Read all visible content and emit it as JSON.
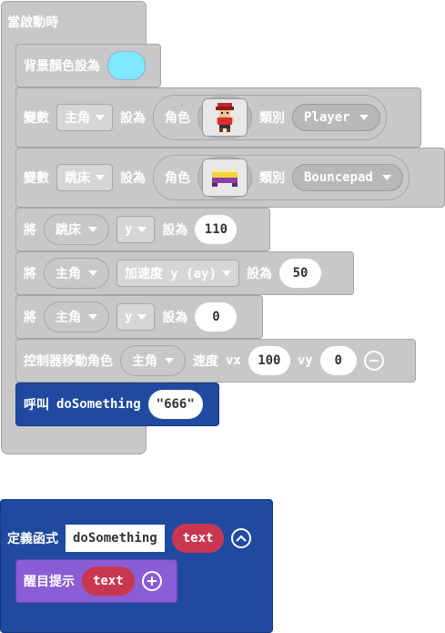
{
  "start_event": {
    "label": "當啟動時"
  },
  "set_bg": {
    "label": "背景顏色設為",
    "color": "#7fe8ff"
  },
  "set_hero": {
    "var_label": "變數",
    "var_name": "主角",
    "set_label": "設為",
    "sprite_label": "角色",
    "kind_label": "類別",
    "kind_value": "Player",
    "sprite_icon": "player-sprite-icon"
  },
  "set_bounce": {
    "var_label": "變數",
    "var_name": "跳床",
    "set_label": "設為",
    "sprite_label": "角色",
    "kind_label": "類別",
    "kind_value": "Bouncepad",
    "sprite_icon": "bouncepad-sprite-icon"
  },
  "set_y": {
    "label": "將",
    "target": "跳床",
    "prop": "y",
    "set_label": "設為",
    "value": "110"
  },
  "set_ay": {
    "label": "將",
    "target": "主角",
    "prop": "加速度 y (ay)",
    "set_label": "設為",
    "value": "50"
  },
  "set_y2": {
    "label": "將",
    "target": "主角",
    "prop": "y",
    "set_label": "設為",
    "value": "0"
  },
  "controller": {
    "label": "控制器移動角色",
    "target": "主角",
    "speed_label": "速度",
    "vx_label": "vx",
    "vx": "100",
    "vy_label": "vy",
    "vy": "0"
  },
  "call": {
    "label": "呼叫",
    "func": "doSomething",
    "arg": "\"666\""
  },
  "func_def": {
    "label": "定義函式",
    "name": "doSomething",
    "param": "text"
  },
  "splash": {
    "label": "醒目提示",
    "arg": "text"
  },
  "colors": {
    "grey": "#c8c8c8",
    "blue": "#1f4aa0",
    "purple": "#8a5cd6",
    "red": "#c9364f",
    "bg_swatch": "#7fe8ff"
  }
}
